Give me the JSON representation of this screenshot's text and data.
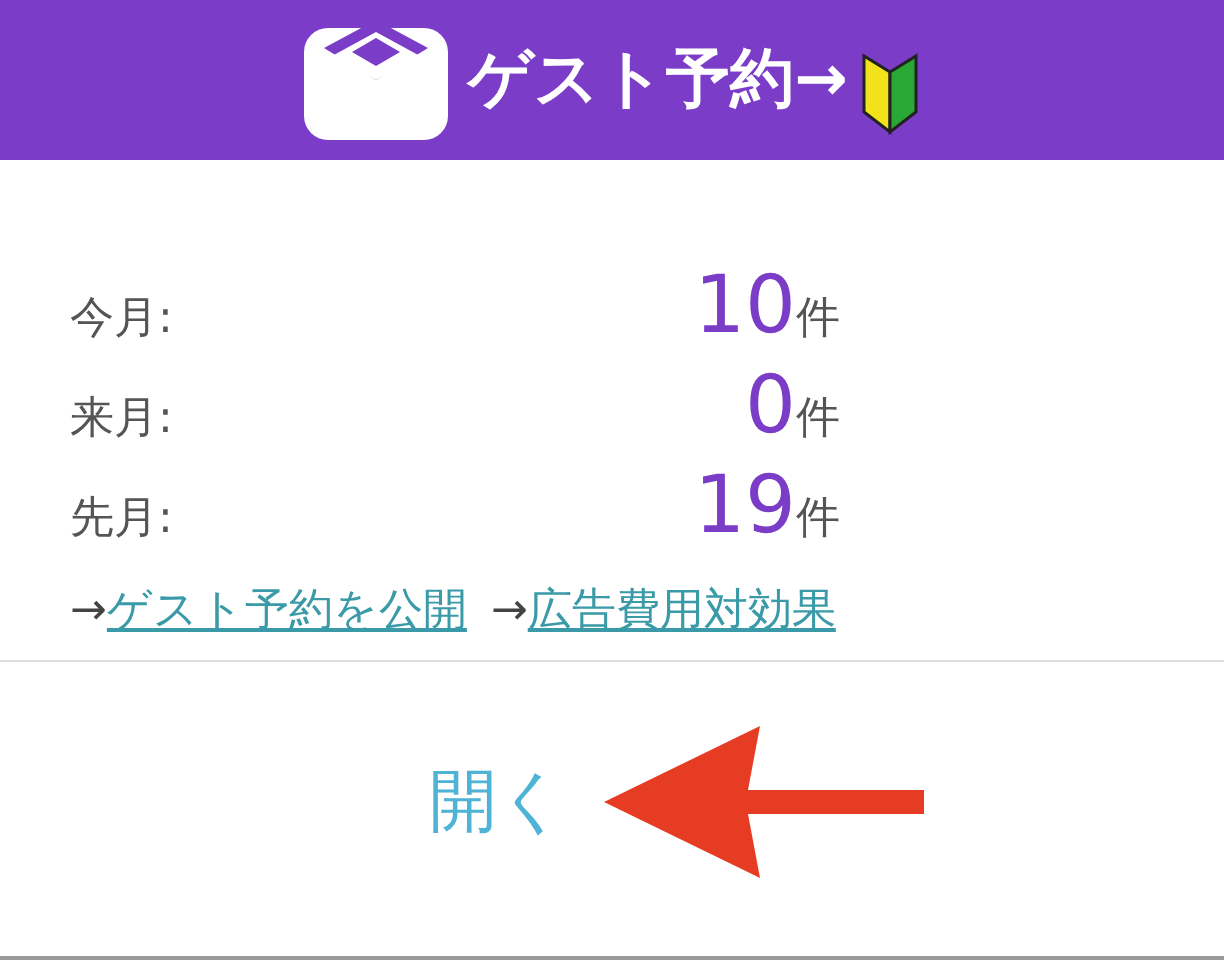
{
  "header": {
    "title": "ゲスト予約→"
  },
  "stats": [
    {
      "label": "今月:",
      "value": "10",
      "unit": "件"
    },
    {
      "label": "来月:",
      "value": "0",
      "unit": "件"
    },
    {
      "label": "先月:",
      "value": "19",
      "unit": "件"
    }
  ],
  "links": [
    {
      "prefix": "→",
      "label": "ゲスト予約を公開"
    },
    {
      "prefix": "→",
      "label": "広告費用対効果"
    }
  ],
  "action": {
    "label": "開く"
  }
}
